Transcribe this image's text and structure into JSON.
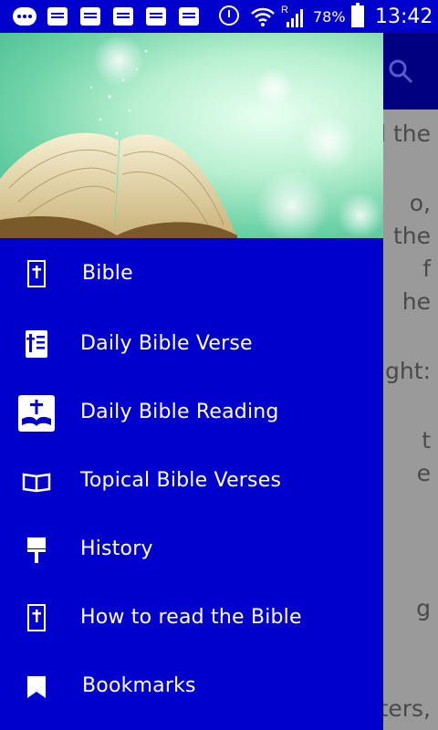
{
  "status_bar": {
    "battery_percent": "78%",
    "time": "13:42",
    "signal_label": "R"
  },
  "background": {
    "content_lines": [
      "d the",
      "o,",
      "the",
      "f",
      "he",
      "ght:",
      "t",
      "e",
      "g",
      "ters,"
    ]
  },
  "drawer": {
    "menu": [
      {
        "label": "Bible",
        "icon": "bible-icon"
      },
      {
        "label": "Daily Bible Verse",
        "icon": "daily-verse-icon"
      },
      {
        "label": "Daily Bible Reading",
        "icon": "daily-reading-icon"
      },
      {
        "label": "Topical Bible Verses",
        "icon": "open-book-icon"
      },
      {
        "label": "History",
        "icon": "paint-roller-icon"
      },
      {
        "label": "How to read the Bible",
        "icon": "bible-icon"
      },
      {
        "label": "Bookmarks",
        "icon": "bookmark-icon"
      }
    ]
  },
  "colors": {
    "drawer": "#0000cc",
    "appbar": "#000080",
    "scrim_content": "#9a9a9a"
  }
}
